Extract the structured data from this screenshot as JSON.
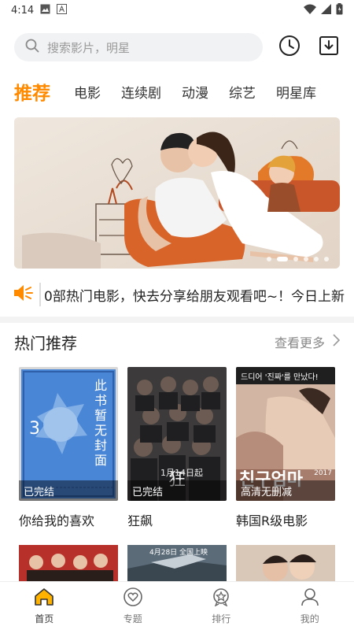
{
  "status": {
    "time": "4:14"
  },
  "search": {
    "placeholder": "搜索影片，明星"
  },
  "tabs": [
    {
      "label": "推荐",
      "active": true
    },
    {
      "label": "电影"
    },
    {
      "label": "连续剧"
    },
    {
      "label": "动漫"
    },
    {
      "label": "综艺"
    },
    {
      "label": "明星库"
    }
  ],
  "banner": {
    "slide_count": 6,
    "active_index": 1
  },
  "notice": {
    "text": "0部热门电影，快去分享给朋友观看吧~！今日上新"
  },
  "section": {
    "title": "热门推荐",
    "more_label": "查看更多"
  },
  "cards": [
    {
      "title": "你给我的喜欢",
      "badge": "已完结",
      "poster_text": "此书暂无封面"
    },
    {
      "title": "狂飙",
      "badge": "已完结",
      "poster_text": "1月14日起"
    },
    {
      "title": "韩国R级电影",
      "badge": "高清无删减",
      "poster_text": "드디어 '진짜'를 만났다!",
      "poster_text2": "2017"
    }
  ],
  "second_row_posters": [
    {
      "poster_text": ""
    },
    {
      "poster_text": "4月28日 全国上映"
    },
    {
      "poster_text": ""
    }
  ],
  "bottom_nav": [
    {
      "label": "首页",
      "icon": "home-icon",
      "active": true
    },
    {
      "label": "专题",
      "icon": "heart-badge-icon"
    },
    {
      "label": "排行",
      "icon": "ranking-icon"
    },
    {
      "label": "我的",
      "icon": "user-icon"
    }
  ],
  "colors": {
    "accent": "#ff8a00",
    "text": "#222222",
    "muted": "#888888",
    "search_bg": "#f1f2f4"
  }
}
